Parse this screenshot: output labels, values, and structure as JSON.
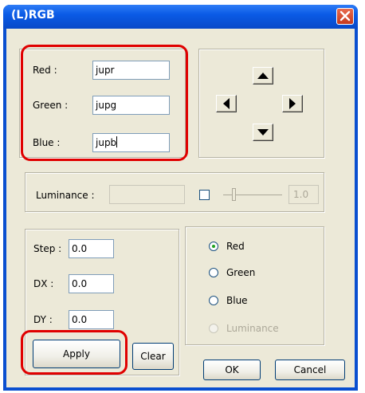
{
  "window": {
    "title": "(L)RGB"
  },
  "channels": {
    "red_label": "Red :",
    "red_value": "jupr",
    "green_label": "Green :",
    "green_value": "jupg",
    "blue_label": "Blue :",
    "blue_value": "jupb"
  },
  "luminance": {
    "label": "Luminance :",
    "input_value": "",
    "checked": false,
    "slider_value": "1.0"
  },
  "offsets": {
    "step_label": "Step :",
    "step_value": "0.0",
    "dx_label": "DX :",
    "dx_value": "0.0",
    "dy_label": "DY :",
    "dy_value": "0.0"
  },
  "target": {
    "options": [
      "Red",
      "Green",
      "Blue",
      "Luminance"
    ],
    "selected": "Red",
    "disabled": [
      "Luminance"
    ]
  },
  "buttons": {
    "apply": "Apply",
    "clear": "Clear",
    "ok": "OK",
    "cancel": "Cancel"
  },
  "colors": {
    "titlebar": "#0a5be6",
    "face": "#ece9d8",
    "highlight": "#e00000",
    "close": "#c6391d"
  }
}
